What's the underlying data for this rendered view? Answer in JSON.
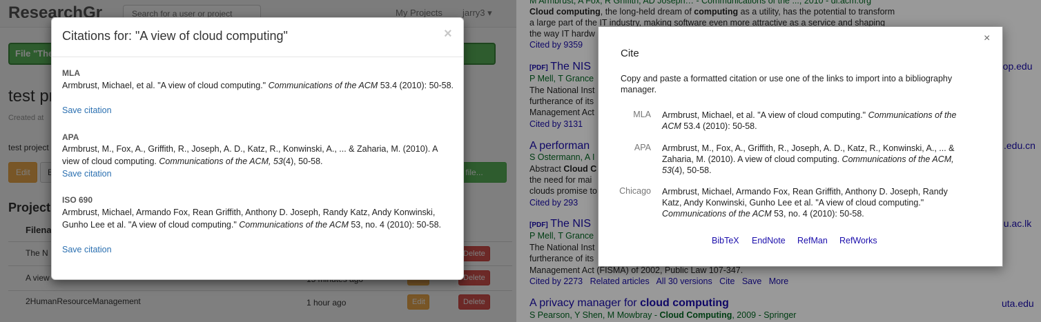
{
  "left_app": {
    "brand": "ResearchGr",
    "search_placeholder": "Search for a user or project",
    "nav_projects": "My Projects",
    "nav_user": "jarry3 ▾",
    "alert_text": "File \"The",
    "project_title": "test pr",
    "created_text": "Created at",
    "description": "test project",
    "edit_button": "Edit",
    "second_button": "E",
    "upload_button": "oad file...",
    "section_title": "Project",
    "table_header": "Filena",
    "rows": [
      {
        "name": "The N",
        "time": "",
        "edit": "",
        "delete": "Delete"
      },
      {
        "name": "A view",
        "time": "15 minutes ago",
        "edit": "Edit",
        "delete": "Delete"
      },
      {
        "name": "2HumanResourceManagement",
        "time": "1 hour ago",
        "edit": "Edit",
        "delete": "Delete"
      }
    ]
  },
  "citations_modal": {
    "title": "Citations for: \"A view of cloud computing\"",
    "close": "×",
    "entries": [
      {
        "style": "MLA",
        "text_before": "Armbrust, Michael, et al. \"A view of cloud computing.\" ",
        "text_italic": "Communications of the ACM",
        "text_after": " 53.4 (2010): 50-58.",
        "save": "Save citation"
      },
      {
        "style": "APA",
        "text_before": "Armbrust, M., Fox, A., Griffith, R., Joseph, A. D., Katz, R., Konwinski, A., ... & Zaharia, M. (2010). A view of cloud computing. ",
        "text_italic": "Communications of the ACM, 53",
        "text_after": "(4), 50-58.",
        "save": "Save citation"
      },
      {
        "style": "ISO 690",
        "text_before": "Armbrust, Michael, Armando Fox, Rean Griffith, Anthony D. Joseph, Randy Katz, Andy Konwinski, Gunho Lee et al. \"A view of cloud computing.\" ",
        "text_italic": "Communications of the ACM",
        "text_after": " 53, no. 4 (2010): 50-58.",
        "save": "Save citation"
      }
    ]
  },
  "scholar": {
    "top_authors": "M Armbrust, A Fox, R Griffith, AD Joseph… - Communications of the ..., 2010 - dl.acm.org",
    "snippet_1a_bold": "Cloud computing",
    "snippet_1a_rest": ", the long-held dream of ",
    "snippet_1a_bold2": "computing",
    "snippet_1a_rest2": " as a utility, has the potential to transform",
    "snippet_1b": "a large part of the IT industry, making software even more attractive as a service and shaping",
    "snippet_1c": "the way IT hardw",
    "cited_1": "Cited by 9359",
    "r2_pdf": "[PDF]",
    "r2_title": "The NIS",
    "r2_domain": "rop.edu",
    "r2_authors": "P Mell, T Grance",
    "r2_snip1": "The National Inst",
    "r2_snip2": "furtherance of its",
    "r2_snip3": "Management Act",
    "cited_2": "Cited by 3131",
    "r3_title": "A performan",
    "r3_domain": ".edu.cn",
    "r3_authors": "S Ostermann, A I",
    "r3_snip1a": "Abstract ",
    "r3_snip1b": "Cloud C",
    "r3_snip2": "the need for mai",
    "r3_snip3": "clouds promise to",
    "cited_3": "Cited by 293",
    "r4_pdf": "[PDF]",
    "r4_title": "The NIS",
    "r4_domain": "eu.ac.lk",
    "r4_authors": "P Mell, T Grance",
    "r4_snip1": "The National Inst",
    "r4_snip2": "furtherance of its",
    "r4_snip3": "Management Act (FISMA) of 2002, Public Law 107-347.",
    "r4_links": [
      "Cited by 2273",
      "Related articles",
      "All 30 versions",
      "Cite",
      "Save",
      "More"
    ],
    "r5_title_plain": "A privacy manager for ",
    "r5_title_bold": "cloud computing",
    "r5_domain": "uta.edu",
    "r5_authors": "S Pearson, Y Shen, M Mowbray - ",
    "r5_authors_bold": "Cloud Computing",
    "r5_authors_rest": ", 2009 - Springer"
  },
  "cite_dialog": {
    "title": "Cite",
    "close": "×",
    "intro": "Copy and paste a formatted citation or use one of the links to import into a bibliography manager.",
    "entries": [
      {
        "style": "MLA",
        "text_before": "Armbrust, Michael, et al. \"A view of cloud computing.\" ",
        "text_italic": "Communications of the ACM",
        "text_after": " 53.4 (2010): 50-58."
      },
      {
        "style": "APA",
        "text_before": "Armbrust, M., Fox, A., Griffith, R., Joseph, A. D., Katz, R., Konwinski, A., ... & Zaharia, M. (2010). A view of cloud computing. ",
        "text_italic": "Communications of the ACM, 53",
        "text_after": "(4), 50-58."
      },
      {
        "style": "Chicago",
        "text_before": "Armbrust, Michael, Armando Fox, Rean Griffith, Anthony D. Joseph, Randy Katz, Andy Konwinski, Gunho Lee et al. \"A view of cloud computing.\" ",
        "text_italic": "Communications of the ACM",
        "text_after": " 53, no. 4 (2010): 50-58."
      }
    ],
    "export_links": [
      "BibTeX",
      "EndNote",
      "RefMan",
      "RefWorks"
    ]
  }
}
